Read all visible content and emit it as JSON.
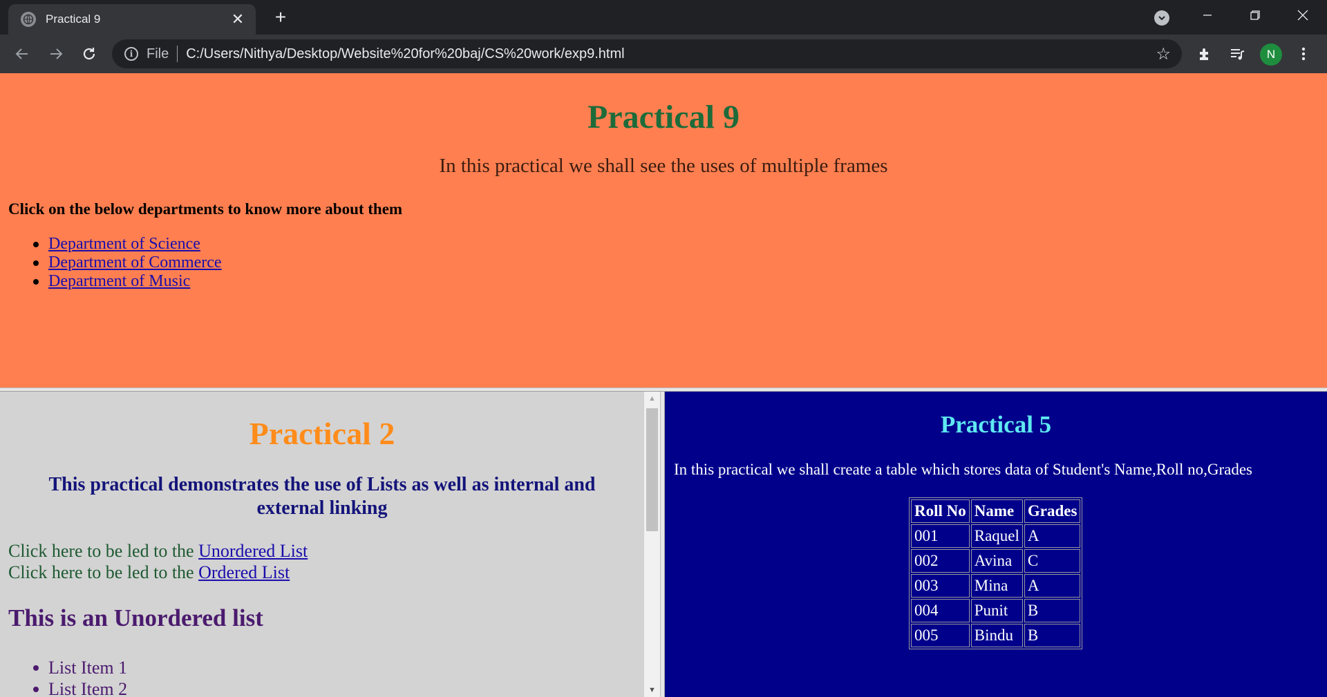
{
  "browser": {
    "tab_title": "Practical 9",
    "new_tab_symbol": "+",
    "address_scheme": "File",
    "address_url": "C:/Users/Nithya/Desktop/Website%20for%20baj/CS%20work/exp9.html",
    "profile_initial": "N"
  },
  "top_frame": {
    "title": "Practical 9",
    "subtitle": "In this practical we shall see the uses of multiple frames",
    "instruction": "Click on the below departments to know more about them",
    "departments": [
      "Department of Science",
      "Department of Commerce",
      "Department of Music"
    ],
    "background": "#ff7f50"
  },
  "left_frame": {
    "title": "Practical 2",
    "description": "This practical demonstrates the use of Lists as well as internal and external linking",
    "lead_text": "Click here to be led to the ",
    "links": [
      "Unordered List",
      "Ordered List"
    ],
    "section_heading": "This is an Unordered list",
    "items": [
      "List Item 1",
      "List Item 2"
    ],
    "background": "#d3d3d3"
  },
  "right_frame": {
    "title": "Practical 5",
    "description": "In this practical we shall create a table which stores data of Student's Name,Roll no,Grades",
    "table": {
      "headers": [
        "Roll No",
        "Name",
        "Grades"
      ],
      "rows": [
        [
          "001",
          "Raquel",
          "A"
        ],
        [
          "002",
          "Avina",
          "C"
        ],
        [
          "003",
          "Mina",
          "A"
        ],
        [
          "004",
          "Punit",
          "B"
        ],
        [
          "005",
          "Bindu",
          "B"
        ]
      ]
    },
    "background": "#00008b"
  },
  "icons": [
    "globe-icon",
    "close-icon",
    "plus-icon",
    "tab-search-icon",
    "minimize-icon",
    "restore-icon",
    "window-close-icon",
    "back-icon",
    "forward-icon",
    "reload-icon",
    "info-icon",
    "star-icon",
    "extensions-icon",
    "media-icon",
    "menu-icon"
  ]
}
